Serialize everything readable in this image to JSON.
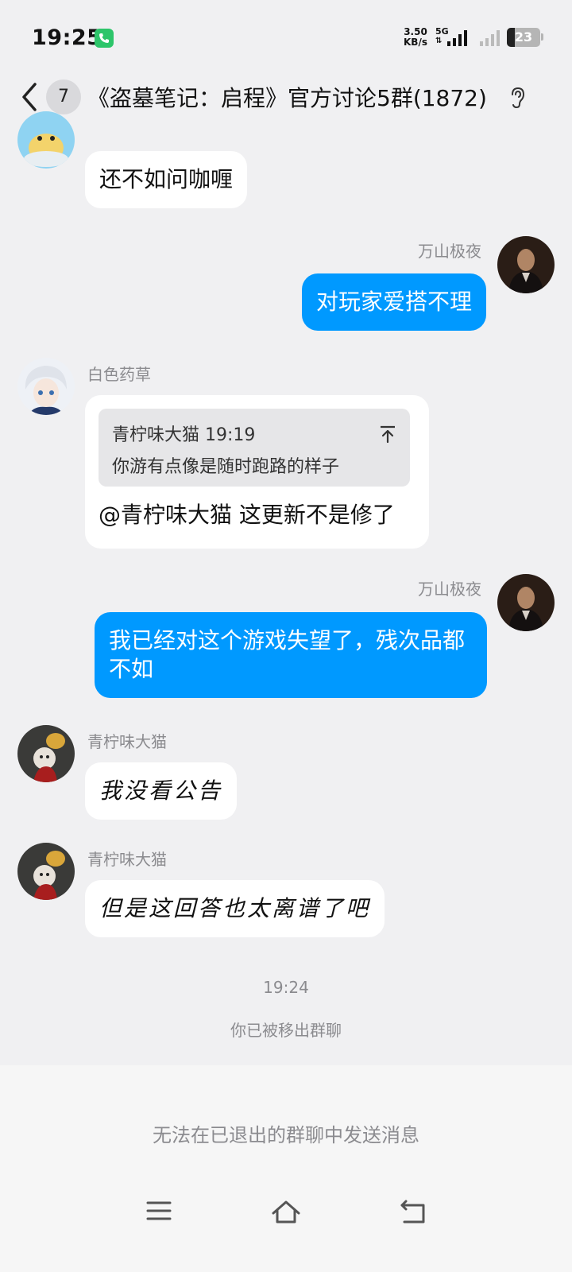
{
  "status_bar": {
    "time": "19:25",
    "speed_value": "3.50",
    "speed_unit": "KB/s",
    "network": "5G",
    "battery": "23",
    "battery_level": 0.23
  },
  "header": {
    "unread_count": "7",
    "title": "《盗墓笔记：启程》官方讨论5群(1872)"
  },
  "messages": [
    {
      "sender": "",
      "text": "还不如问咖喱",
      "direction": "in"
    },
    {
      "sender": "万山极夜",
      "text": "对玩家爱搭不理",
      "direction": "out"
    },
    {
      "sender": "白色药草",
      "direction": "in",
      "quote": {
        "author_time": "青柠味大猫 19:19",
        "text": "你游有点像是随时跑路的样子"
      },
      "text": "@青柠味大猫 这更新不是修了"
    },
    {
      "sender": "万山极夜",
      "text": "我已经对这个游戏失望了，残次品都不如",
      "direction": "out"
    },
    {
      "sender": "青柠味大猫",
      "text": "我没看公告",
      "direction": "in"
    },
    {
      "sender": "青柠味大猫",
      "text": "但是这回答也太离谱了吧",
      "direction": "in"
    }
  ],
  "timestamp": "19:24",
  "system_message": "你已被移出群聊",
  "bottom_notice": "无法在已退出的群聊中发送消息",
  "nav": {
    "menu": "menu-icon",
    "home": "home-icon",
    "back": "back-nav-icon"
  },
  "colors": {
    "accent": "#0099ff",
    "background": "#f0f0f2",
    "bubble_in": "#ffffff"
  }
}
